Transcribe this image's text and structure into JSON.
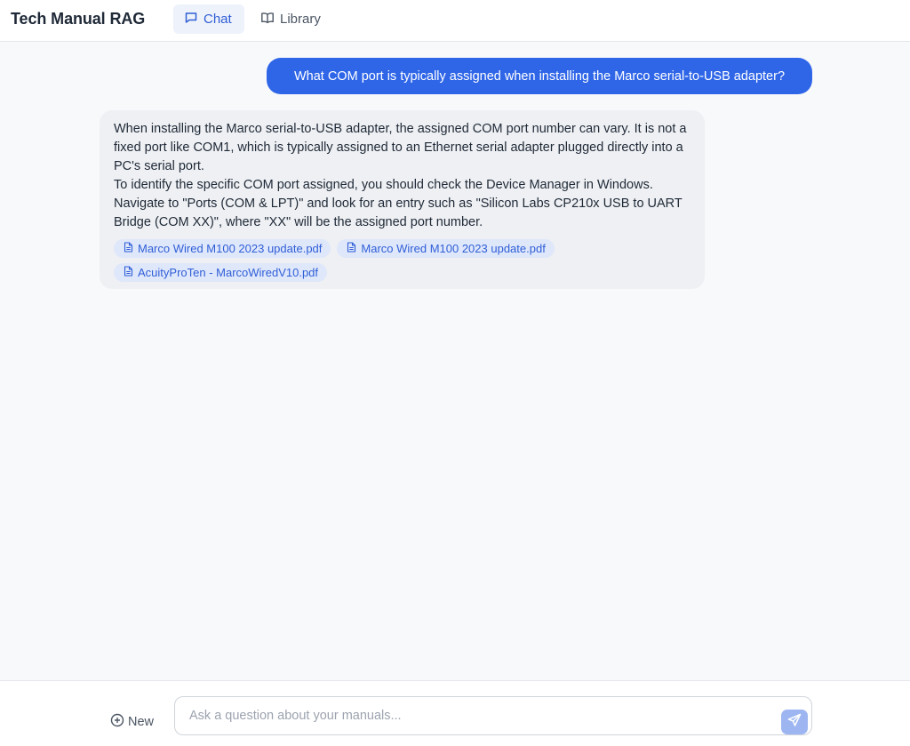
{
  "header": {
    "app_title": "Tech Manual RAG",
    "tabs": [
      {
        "label": "Chat",
        "icon": "chat-bubble-icon",
        "active": true
      },
      {
        "label": "Library",
        "icon": "book-open-icon",
        "active": false
      }
    ]
  },
  "conversation": {
    "user_message": "What COM port is typically assigned when installing the Marco serial-to-USB adapter?",
    "assistant_paragraphs": [
      "When installing the Marco serial-to-USB adapter, the assigned COM port number can vary. It is not a fixed port like COM1, which is typically assigned to an Ethernet serial adapter plugged directly into a PC's serial port.",
      "To identify the specific COM port assigned, you should check the Device Manager in Windows. Navigate to \"Ports (COM & LPT)\" and look for an entry such as \"Silicon Labs CP210x USB to UART Bridge (COM XX)\", where \"XX\" will be the assigned port number."
    ],
    "sources": [
      "Marco Wired M100 2023 update.pdf",
      "Marco Wired M100 2023 update.pdf",
      "AcuityProTen - MarcoWiredV10.pdf"
    ]
  },
  "composer": {
    "new_label": "New",
    "placeholder": "Ask a question about your manuals...",
    "value": ""
  },
  "colors": {
    "accent": "#2f66e8",
    "tab_active_bg": "#eef2fb",
    "source_chip_bg": "#dfe7fb",
    "send_button_disabled": "#9db6f1"
  }
}
